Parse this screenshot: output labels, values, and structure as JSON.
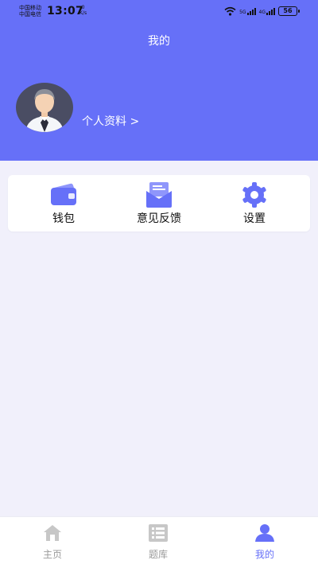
{
  "status_bar": {
    "carrier_1": "中国移动",
    "carrier_2": "中国电信",
    "time": "13:07",
    "net_speed_value": "0",
    "net_speed_unit": "K/s",
    "signal_1_label": "5G",
    "signal_2_label": "4G",
    "battery": "56",
    "icons": [
      "wifi-icon",
      "signal-5g-icon",
      "signal-4g-icon",
      "battery-icon"
    ]
  },
  "header": {
    "title": "我的",
    "profile_link": "个人资料 >"
  },
  "menu": {
    "items": [
      {
        "label": "钱包",
        "icon": "wallet-icon"
      },
      {
        "label": "意见反馈",
        "icon": "feedback-mail-icon"
      },
      {
        "label": "设置",
        "icon": "gear-icon"
      }
    ]
  },
  "tabbar": {
    "tabs": [
      {
        "label": "主页",
        "icon": "home-icon",
        "active": false
      },
      {
        "label": "题库",
        "icon": "question-bank-icon",
        "active": false
      },
      {
        "label": "我的",
        "icon": "user-icon",
        "active": true
      }
    ]
  },
  "colors": {
    "accent": "#6670f8",
    "page_background": "#f1f0fb",
    "inactive_tab": "#9a9a9a"
  }
}
